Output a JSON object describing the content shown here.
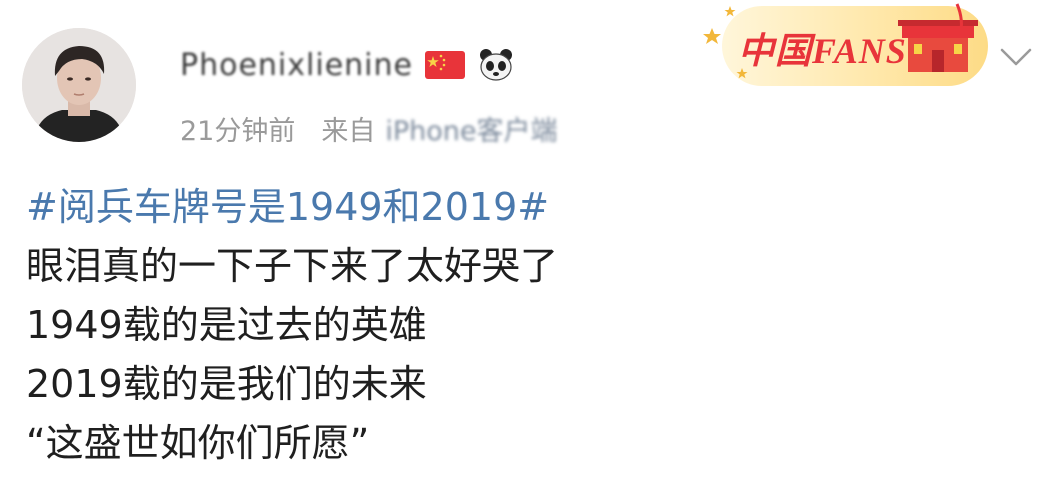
{
  "post": {
    "username": "Phoenixlienine",
    "time": "21分钟前",
    "source_prefix": "来自",
    "source_device": "iPhone客户端",
    "badge_text": "中国FANS",
    "colors": {
      "topic": "#4a79ad",
      "meta": "#9a9a9a",
      "badge": "#e8343a"
    },
    "icons": [
      "china-flag-icon",
      "panda-icon",
      "chevron-down-icon"
    ],
    "content": {
      "topic": "#阅兵车牌号是1949和2019#",
      "lines": [
        "眼泪真的一下子下来了太好哭了",
        "1949载的是过去的英雄",
        "2019载的是我们的未来",
        "“这盛世如你们所愿”"
      ]
    }
  }
}
